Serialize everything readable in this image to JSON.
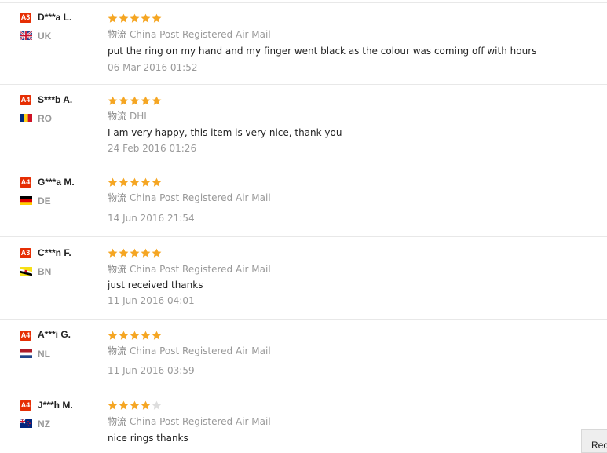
{
  "reviews": [
    {
      "level": "A3",
      "buyer": "D***a L.",
      "flag": "uk-flag-icon",
      "country": "UK",
      "stars": 5,
      "logistics_label": "物流",
      "logistics": "China Post Registered Air Mail",
      "feedback": "put the ring on my hand and my finger went black as the colour was coming off with hours",
      "date": "06 Mar 2016 01:52"
    },
    {
      "level": "A4",
      "buyer": "S***b A.",
      "flag": "ro-flag-icon",
      "country": "RO",
      "stars": 5,
      "logistics_label": "物流",
      "logistics": "DHL",
      "feedback": "I am very happy, this item is very nice, thank you",
      "date": "24 Feb 2016 01:26"
    },
    {
      "level": "A4",
      "buyer": "G***a M.",
      "flag": "de-flag-icon",
      "country": "DE",
      "stars": 5,
      "logistics_label": "物流",
      "logistics": "China Post Registered Air Mail",
      "feedback": "",
      "date": "14 Jun 2016 21:54"
    },
    {
      "level": "A3",
      "buyer": "C***n F.",
      "flag": "bn-flag-icon",
      "country": "BN",
      "stars": 5,
      "logistics_label": "物流",
      "logistics": "China Post Registered Air Mail",
      "feedback": "just received thanks",
      "date": "11 Jun 2016 04:01"
    },
    {
      "level": "A4",
      "buyer": "A***i G.",
      "flag": "nl-flag-icon",
      "country": "NL",
      "stars": 5,
      "logistics_label": "物流",
      "logistics": "China Post Registered Air Mail",
      "feedback": "",
      "date": "11 Jun 2016 03:59"
    },
    {
      "level": "A4",
      "buyer": "J***h M.",
      "flag": "nz-flag-icon",
      "country": "NZ",
      "stars": 4,
      "logistics_label": "物流",
      "logistics": "China Post Registered Air Mail",
      "feedback": "nice rings thanks",
      "date": ""
    }
  ],
  "corner_button": {
    "label": "Rec"
  },
  "colors": {
    "star_on": "#f5a623",
    "star_off": "#dddddd",
    "level_badge": "#e62e04"
  }
}
